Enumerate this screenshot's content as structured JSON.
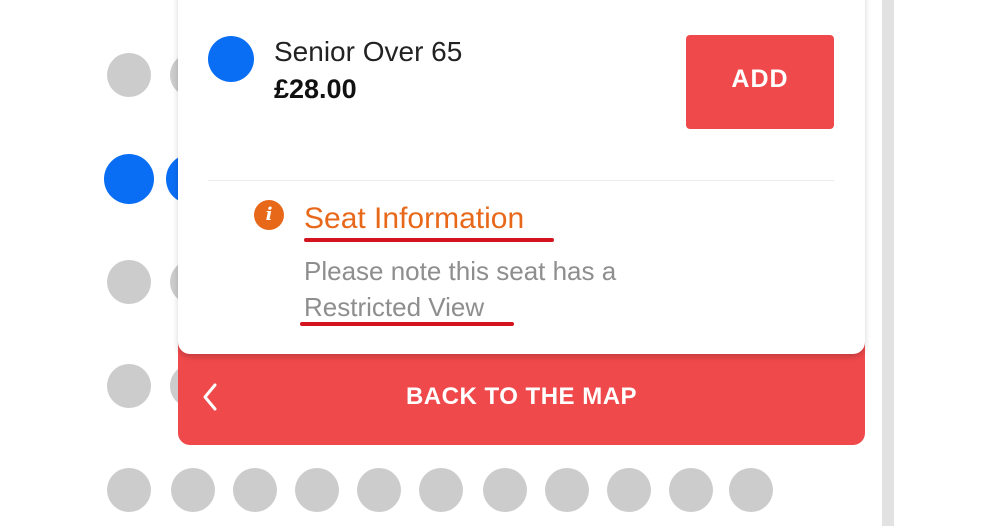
{
  "ticket": {
    "type": "Senior Over 65",
    "price": "£28.00",
    "add_label": "ADD"
  },
  "seat_info": {
    "title": "Seat Information",
    "note_line1": "Please note this seat has a",
    "note_line2": "Restricted View"
  },
  "back_button": {
    "label": "BACK TO THE MAP"
  },
  "colors": {
    "accent_red": "#f0494b",
    "selected_blue": "#0a6ef5",
    "info_orange": "#e8681a",
    "seat_grey": "#cccccc"
  },
  "icons": {
    "info": "info-icon",
    "back": "chevron-left-icon"
  }
}
